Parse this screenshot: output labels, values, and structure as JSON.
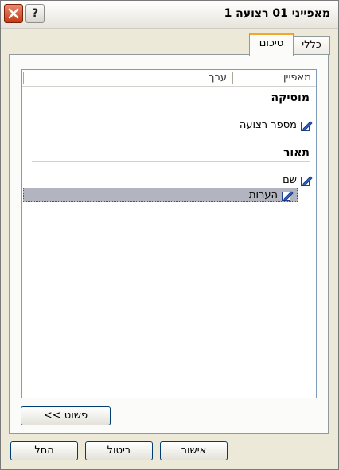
{
  "window": {
    "title": "מאפייני 01 רצועה 1",
    "help_label": "?"
  },
  "tabs": [
    {
      "label": "כללי"
    },
    {
      "label": "סיכום"
    }
  ],
  "list": {
    "columns": {
      "property": "מאפיין",
      "value": "ערך"
    },
    "groups": [
      {
        "title": "מוסיקה",
        "rows": [
          {
            "label": "מספר רצועה"
          }
        ]
      },
      {
        "title": "תאור",
        "rows": [
          {
            "label": "שם"
          },
          {
            "label": "הערות"
          }
        ]
      }
    ]
  },
  "buttons": {
    "simple": "<< פשוט",
    "ok": "אישור",
    "cancel": "ביטול",
    "apply": "החל"
  },
  "icons": {
    "close": "close-icon",
    "edit": "edit-pencil-icon"
  }
}
